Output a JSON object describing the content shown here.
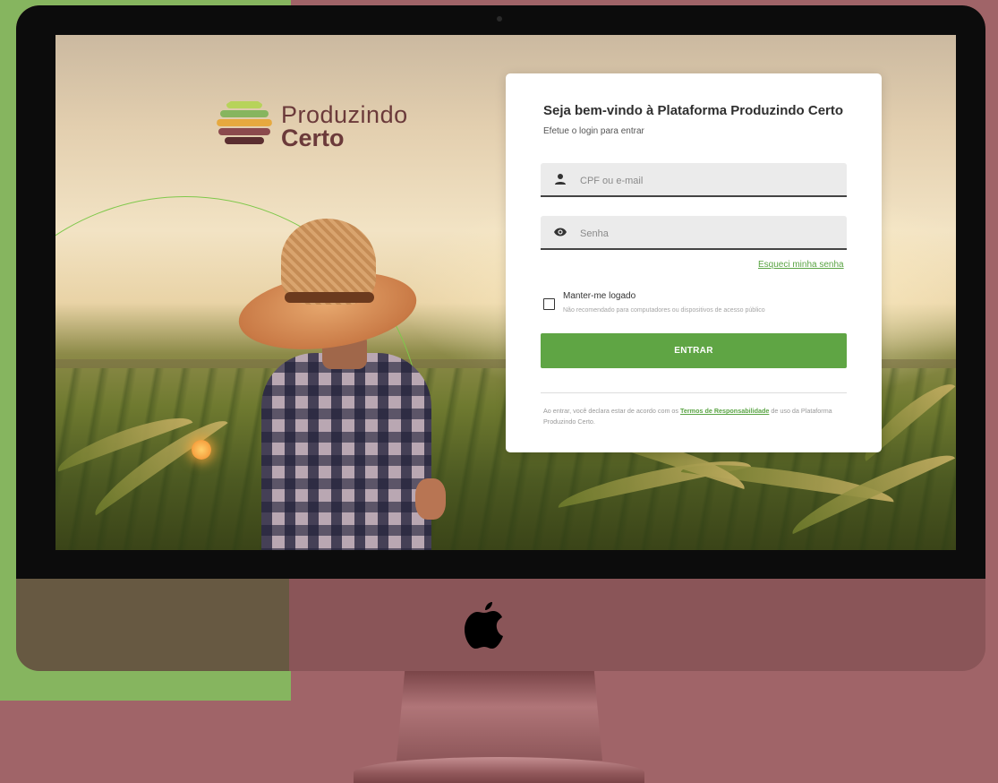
{
  "brand": {
    "line1": "Produzindo",
    "line2": "Certo",
    "text_color": "#6b3a3a",
    "logo_stripes": [
      "#b7d35a",
      "#86b55f",
      "#e6a93f",
      "#8b4a4d",
      "#5b2e30"
    ]
  },
  "login": {
    "title": "Seja bem-vindo à Plataforma Produzindo Certo",
    "subtitle": "Efetue o login para entrar",
    "user_field": {
      "placeholder": "CPF ou e-mail",
      "value": "",
      "icon": "person-icon"
    },
    "password_field": {
      "placeholder": "Senha",
      "value": "",
      "icon": "eye-icon"
    },
    "forgot_link": "Esqueci minha senha",
    "remember": {
      "label": "Manter-me logado",
      "note": "Não recomendado para computadores ou dispositivos de acesso público",
      "checked": false
    },
    "submit_label": "ENTRAR",
    "terms": {
      "prefix": "Ao entrar, você declara estar de acordo com os",
      "link": "Termos de Responsabilidade",
      "suffix": "de uso da Plataforma Produzindo Certo."
    }
  },
  "colors": {
    "accent_green": "#5fa544",
    "background_rose": "#a06468",
    "background_green": "#86b55f"
  },
  "device": {
    "logo_icon": "apple-icon"
  }
}
